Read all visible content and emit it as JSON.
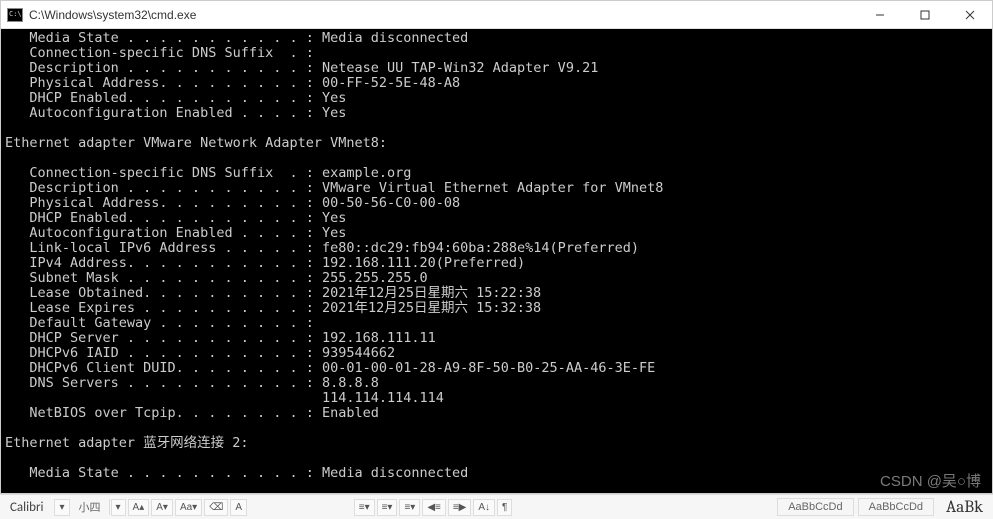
{
  "window": {
    "title": "C:\\Windows\\system32\\cmd.exe"
  },
  "adapter1": {
    "media_state": "   Media State . . . . . . . . . . . : ",
    "media_state_v": "Media disconnected",
    "dns_suffix": "   Connection-specific DNS Suffix  . :",
    "description": "   Description . . . . . . . . . . . : ",
    "description_v": "Netease UU TAP-Win32 Adapter V9.21",
    "phys_addr": "   Physical Address. . . . . . . . . : ",
    "phys_addr_v": "00-FF-52-5E-48-A8",
    "dhcp": "   DHCP Enabled. . . . . . . . . . . : ",
    "dhcp_v": "Yes",
    "autoconf": "   Autoconfiguration Enabled . . . . : ",
    "autoconf_v": "Yes"
  },
  "adapter2": {
    "header": "Ethernet adapter VMware Network Adapter VMnet8:",
    "dns_suffix": "   Connection-specific DNS Suffix  . : ",
    "dns_suffix_v": "example.org",
    "description": "   Description . . . . . . . . . . . : ",
    "description_v": "VMware Virtual Ethernet Adapter for VMnet8",
    "phys_addr": "   Physical Address. . . . . . . . . : ",
    "phys_addr_v": "00-50-56-C0-00-08",
    "dhcp": "   DHCP Enabled. . . . . . . . . . . : ",
    "dhcp_v": "Yes",
    "autoconf": "   Autoconfiguration Enabled . . . . : ",
    "autoconf_v": "Yes",
    "linklocal": "   Link-local IPv6 Address . . . . . : ",
    "linklocal_v": "fe80::dc29:fb94:60ba:288e%14(Preferred)",
    "ipv4": "   IPv4 Address. . . . . . . . . . . : ",
    "ipv4_v": "192.168.111.20(Preferred)",
    "subnet": "   Subnet Mask . . . . . . . . . . . : ",
    "subnet_v": "255.255.255.0",
    "lease_obt": "   Lease Obtained. . . . . . . . . . : ",
    "lease_obt_v": "2021年12月25日星期六 15:22:38",
    "lease_exp": "   Lease Expires . . . . . . . . . . : ",
    "lease_exp_v": "2021年12月25日星期六 15:32:38",
    "gateway": "   Default Gateway . . . . . . . . . :",
    "dhcp_server": "   DHCP Server . . . . . . . . . . . : ",
    "dhcp_server_v": "192.168.111.11",
    "dhcpv6_iaid": "   DHCPv6 IAID . . . . . . . . . . . : ",
    "dhcpv6_iaid_v": "939544662",
    "dhcpv6_duid": "   DHCPv6 Client DUID. . . . . . . . : ",
    "dhcpv6_duid_v": "00-01-00-01-28-A9-8F-50-B0-25-AA-46-3E-FE",
    "dns": "   DNS Servers . . . . . . . . . . . : ",
    "dns_v1": "8.8.8.8",
    "dns2": "                                       ",
    "dns_v2": "114.114.114.114",
    "netbios": "   NetBIOS over Tcpip. . . . . . . . : ",
    "netbios_v": "Enabled"
  },
  "adapter3": {
    "header": "Ethernet adapter 蓝牙网络连接 2:",
    "media_state": "   Media State . . . . . . . . . . . : ",
    "media_state_v": "Media disconnected"
  },
  "watermark": "CSDN @吴○博",
  "strip": {
    "font": "Calibri",
    "size_label": "小四",
    "a_label": "A",
    "style1": "AaBbCcDd",
    "style2": "AaBbCcDd",
    "aabb": "AaBk"
  }
}
